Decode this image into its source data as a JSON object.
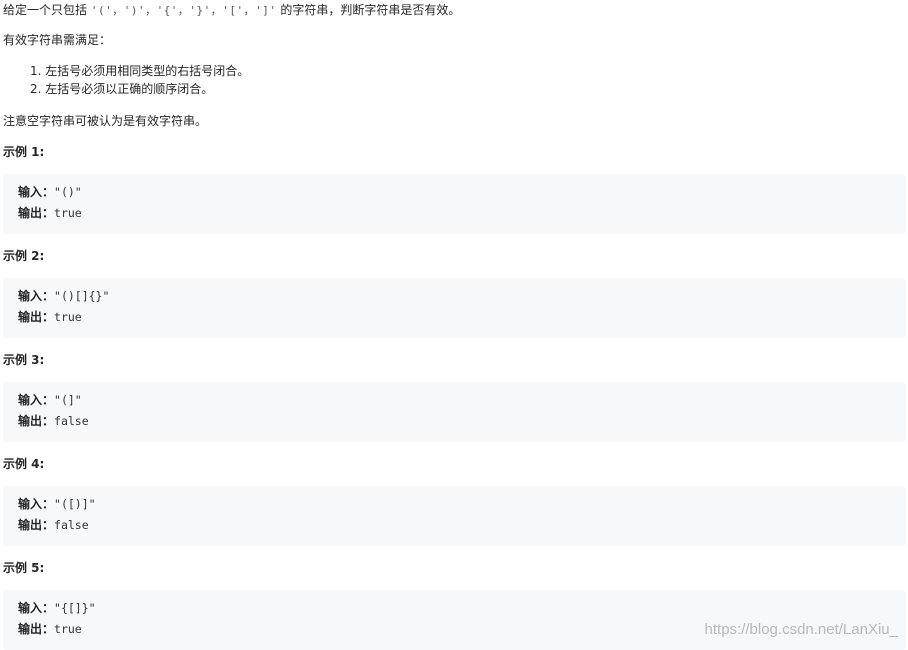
{
  "intro": {
    "prefix": "给定一个只包括 ",
    "chars": "'('，')'，'{'，'}'，'['，']'",
    "suffix": " 的字符串，判断字符串是否有效。"
  },
  "requirement": "有效字符串需满足：",
  "rules": [
    "1. 左括号必须用相同类型的右括号闭合。",
    "2. 左括号必须以正确的顺序闭合。"
  ],
  "note": "注意空字符串可被认为是有效字符串。",
  "examples": [
    {
      "title": "示例 1:",
      "input_label": "输入：",
      "input": "\"()\"",
      "output_label": "输出：",
      "output": "true"
    },
    {
      "title": "示例 2:",
      "input_label": "输入：",
      "input": "\"()[]{}\"",
      "output_label": "输出：",
      "output": "true"
    },
    {
      "title": "示例 3:",
      "input_label": "输入：",
      "input": "\"(]\"",
      "output_label": "输出：",
      "output": "false"
    },
    {
      "title": "示例 4:",
      "input_label": "输入：",
      "input": "\"([)]\"",
      "output_label": "输出：",
      "output": "false"
    },
    {
      "title": "示例 5:",
      "input_label": "输入：",
      "input": "\"{[]}\"",
      "output_label": "输出：",
      "output": "true"
    }
  ],
  "watermark": "https://blog.csdn.net/LanXiu_"
}
